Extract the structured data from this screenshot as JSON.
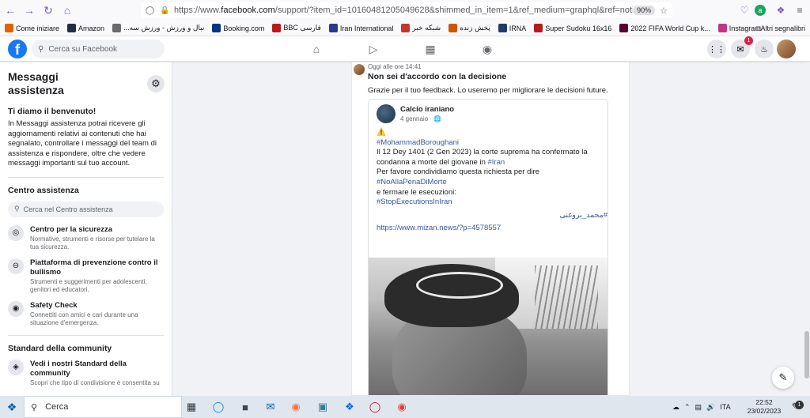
{
  "browser": {
    "url_prefix": "https://www.",
    "url_domain": "facebook.com",
    "url_rest": "/support/?item_id=10160481205049628&shimmed_in_item=1&ref_medium=graphql&ref=notif&notif_t=",
    "zoom": "90%"
  },
  "bookmarks": {
    "items": [
      {
        "label": "Come iniziare",
        "color": "#e66000"
      },
      {
        "label": "Amazon",
        "color": "#232f3e"
      },
      {
        "label": "...نبال و ورزش - ورزش سه",
        "color": "#6a6a6a"
      },
      {
        "label": "Booking.com",
        "color": "#003580"
      },
      {
        "label": "BBC فارسی",
        "color": "#bb1919"
      },
      {
        "label": "Iran International",
        "color": "#2b3a8c"
      },
      {
        "label": "شبکه خبر",
        "color": "#c0392b"
      },
      {
        "label": "پخش زنده",
        "color": "#d35400"
      },
      {
        "label": "IRNA",
        "color": "#1f3b6b"
      },
      {
        "label": "Super Sudoku 16x16",
        "color": "#b71c1c"
      },
      {
        "label": "2022 FIFA World Cup k...",
        "color": "#56042c"
      },
      {
        "label": "Instagram",
        "color": "#c13584"
      }
    ],
    "other": "Altri segnalibri"
  },
  "fb": {
    "logo": "f",
    "search_placeholder": "Cerca su Facebook",
    "messenger_badge": "1"
  },
  "sidebar": {
    "title": "Messaggi assistenza",
    "welcome_title": "Ti diamo il benvenuto!",
    "welcome_text": "In Messaggi assistenza potrai ricevere gli aggiornamenti relativi ai contenuti che hai segnalato, controllare i messaggi del team di assistenza e rispondere, oltre che vedere messaggi importanti sul tuo account.",
    "help_center_title": "Centro assistenza",
    "help_search_placeholder": "Cerca nel Centro assistenza",
    "items": [
      {
        "title": "Centro per la sicurezza",
        "desc": "Normative, strumenti e risorse per tutelare la tua sicurezza.",
        "icon": "life-ring-icon"
      },
      {
        "title": "Piattaforma di prevenzione contro il bullismo",
        "desc": "Strumenti e suggerimenti per adolescenti, genitori ed educatori.",
        "icon": "minus-circle-icon"
      },
      {
        "title": "Safety Check",
        "desc": "Connettiti con amici e cari durante una situazione d'emergenza.",
        "icon": "safety-check-icon"
      }
    ],
    "community_title": "Standard della community",
    "community_items": [
      {
        "title": "Vedi i nostri Standard della community",
        "desc": "Scopri che tipo di condivisione è consentita su",
        "icon": "shield-icon"
      }
    ]
  },
  "message": {
    "time": "Oggi alle ore 14:41",
    "title": "Non sei d'accordo con la decisione",
    "text": "Grazie per il tuo feedback. Lo useremo per migliorare le decisioni future."
  },
  "post": {
    "author": "Calcio iraniano",
    "date": "4 gennaio · ",
    "warning": "⚠️",
    "hashtag1": "#MohammadBoroughani",
    "line1": "Il 12 Dey 1401 (2 Gen 2023) la corte suprema ha confermato la",
    "line2": "condanna a morte del giovane in ",
    "hashtag_iran": "#Iran",
    "line3": "Per favore condividiamo questa richiesta per dire ",
    "hashtag_no": "#NoAllaPenaDiMorte",
    "line4": "e fermare le esecuzioni:",
    "hashtag_stop": "#StopExecutionsInIran",
    "persian_tag": "#محمد_بروغنی",
    "link": "https://www.mizan.news/?p=4578557"
  },
  "taskbar": {
    "search_label": "Cerca",
    "lang": "ITA",
    "time": "22:52",
    "date": "23/02/2023",
    "notif_count": "1"
  },
  "colors": {
    "fb_blue": "#1877f2",
    "link": "#385898",
    "badge_red": "#e41e3f"
  }
}
